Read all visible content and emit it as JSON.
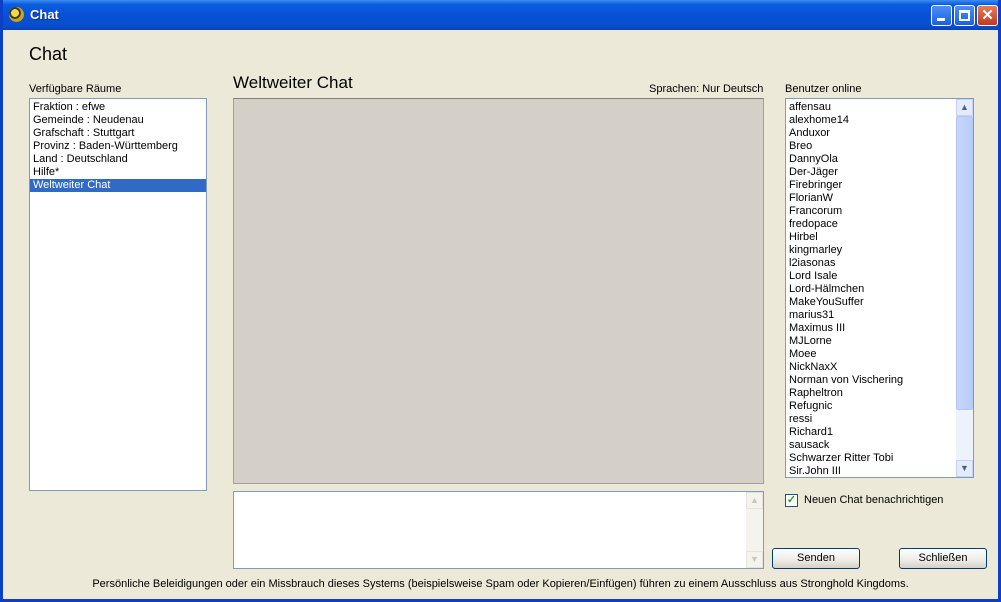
{
  "window": {
    "title": "Chat"
  },
  "heading": "Chat",
  "rooms": {
    "label": "Verfügbare Räume",
    "items": [
      "Fraktion : efwe",
      "Gemeinde : Neudenau",
      "Grafschaft : Stuttgart",
      "Provinz : Baden-Württemberg",
      "Land : Deutschland",
      "Hilfe*",
      "Weltweiter Chat"
    ],
    "selected": "Weltweiter Chat"
  },
  "chat": {
    "title": "Weltweiter Chat",
    "language": "Sprachen: Nur Deutsch"
  },
  "users": {
    "label": "Benutzer online",
    "items": [
      "affensau",
      "alexhome14",
      "Anduxor",
      "Breo",
      "DannyOla",
      "Der-Jäger",
      "Firebringer",
      "FlorianW",
      "Francorum",
      "fredopace",
      "Hirbel",
      "kingmarley",
      "l2iasonas",
      "Lord Isale",
      "Lord-Hälmchen",
      "MakeYouSuffer",
      "marius31",
      "Maximus III",
      "MJLorne",
      "Moee",
      "NickNaxX",
      "Norman von Vischering",
      "Rapheltron",
      "Refugnic",
      "ressi",
      "Richard1",
      "sausack",
      "Schwarzer Ritter Tobi",
      "Sir.John III"
    ]
  },
  "notify": {
    "label": "Neuen Chat benachrichtigen",
    "checked": true
  },
  "buttons": {
    "send": "Senden",
    "close": "Schließen"
  },
  "footer": "Persönliche Beleidigungen oder ein Missbrauch dieses Systems (beispielsweise Spam oder Kopieren/Einfügen) führen zu einem Ausschluss aus Stronghold Kingdoms."
}
